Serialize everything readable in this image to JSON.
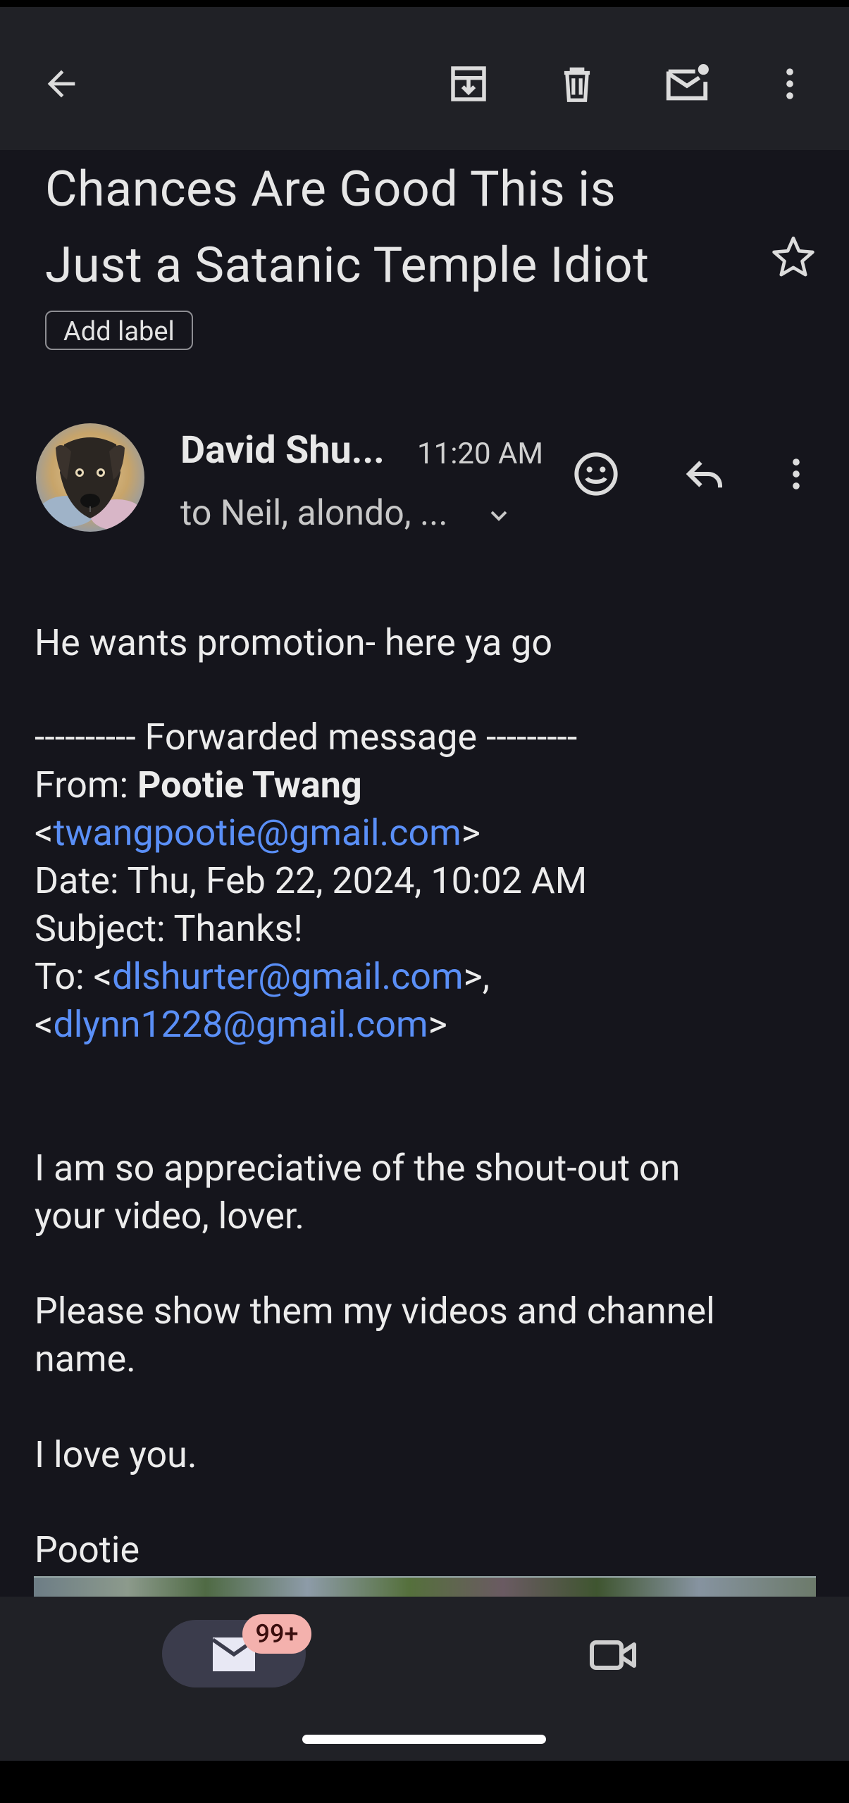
{
  "toolbar": {
    "back_icon": "arrow-back-icon",
    "archive_icon": "archive-icon",
    "delete_icon": "trash-icon",
    "mark_unread_icon": "mark-unread-icon",
    "more_icon": "more-vert-icon"
  },
  "email": {
    "subject_line1": "Chances Are Good This is",
    "subject_line2": "Just a Satanic Temple Idiot",
    "add_label": "Add label",
    "sender": "David Shu...",
    "time": "11:20 AM",
    "recipients": "to Neil, alondo, ..."
  },
  "body": {
    "intro": "He wants promotion- here ya go",
    "forward_header": "---------- Forwarded message ---------",
    "from_label": "From: ",
    "from_name": "Pootie Twang",
    "from_email": "twangpootie@gmail.com",
    "lt": "<",
    "gt": ">",
    "gt_comma": ">,",
    "date_line": "Date: Thu, Feb 22, 2024, 10:02 AM",
    "subject_line": "Subject: Thanks!",
    "to_prefix": "To: <",
    "to_email1": "dlshurter@gmail.com",
    "to_email2": "dlynn1228@gmail.com",
    "para1_line1": "I am so appreciative of the shout-out on",
    "para1_line2": "your video, lover.",
    "para2_line1": "Please show them my videos and channel",
    "para2_line2": "name.",
    "para3": "I love you.",
    "signature": "Pootie"
  },
  "bottom_nav": {
    "mail_badge": "99+",
    "mail_icon": "mail-icon",
    "meet_icon": "video-camera-icon"
  },
  "colors": {
    "background": "#15151c",
    "bar": "#202126",
    "link": "#5a8ff7",
    "badge": "#f4b1ad"
  }
}
